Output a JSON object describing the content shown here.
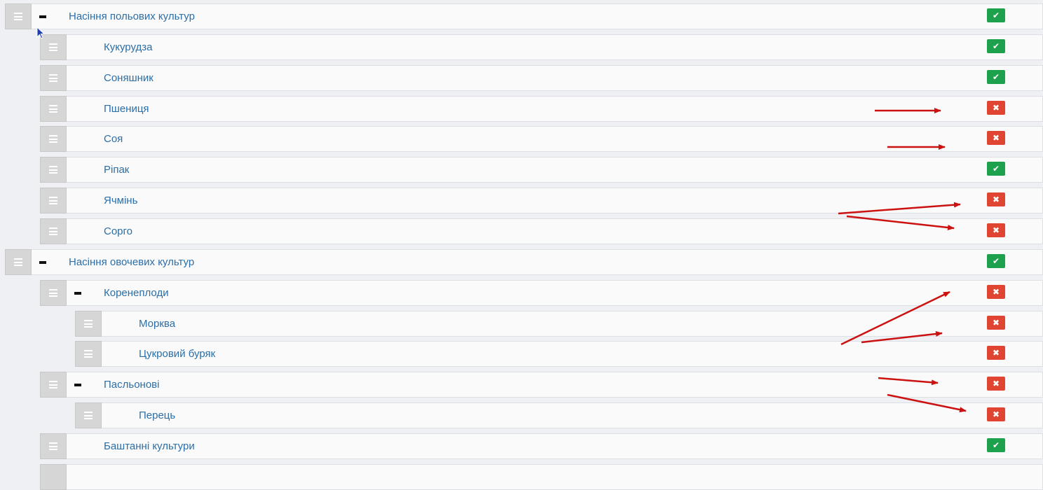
{
  "colors": {
    "status_on": "#1ea14d",
    "status_off": "#e04532",
    "label": "#2b6ea8",
    "annotation_arrow": "#cc1111"
  },
  "icons": {
    "drag_handle": "hamburger-drag-icon",
    "collapse": "minus-icon",
    "enabled": "check-icon",
    "disabled": "cross-icon",
    "cursor": "mouse-pointer-icon"
  },
  "rows": [
    {
      "label": "Насіння польових культур",
      "level": 0,
      "collapsible": true,
      "enabled": true
    },
    {
      "label": "Кукурудза",
      "level": 1,
      "collapsible": false,
      "enabled": true
    },
    {
      "label": "Соняшник",
      "level": 1,
      "collapsible": false,
      "enabled": true
    },
    {
      "label": "Пшениця",
      "level": 1,
      "collapsible": false,
      "enabled": false
    },
    {
      "label": "Соя",
      "level": 1,
      "collapsible": false,
      "enabled": false
    },
    {
      "label": "Ріпак",
      "level": 1,
      "collapsible": false,
      "enabled": true
    },
    {
      "label": "Ячмінь",
      "level": 1,
      "collapsible": false,
      "enabled": false
    },
    {
      "label": "Сорго",
      "level": 1,
      "collapsible": false,
      "enabled": false
    },
    {
      "label": "Насіння овочевих культур",
      "level": 0,
      "collapsible": true,
      "enabled": true
    },
    {
      "label": "Коренеплоди",
      "level": 1,
      "collapsible": true,
      "enabled": false
    },
    {
      "label": "Морква",
      "level": 2,
      "collapsible": false,
      "enabled": false
    },
    {
      "label": "Цукровий буряк",
      "level": 2,
      "collapsible": false,
      "enabled": false
    },
    {
      "label": "Пасльонові",
      "level": 1,
      "collapsible": true,
      "enabled": false
    },
    {
      "label": "Перець",
      "level": 2,
      "collapsible": false,
      "enabled": false
    },
    {
      "label": "Баштанні культури",
      "level": 1,
      "collapsible": false,
      "enabled": true
    }
  ]
}
